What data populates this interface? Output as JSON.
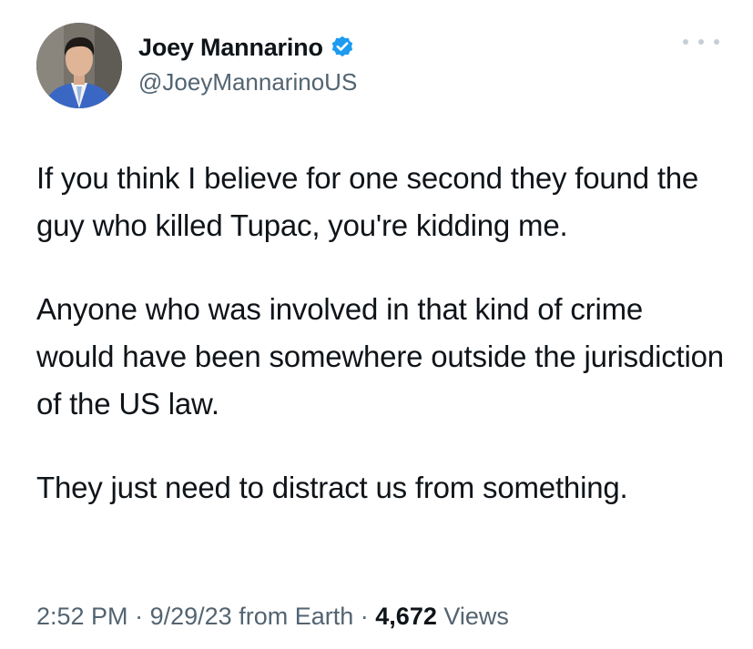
{
  "header": {
    "cut_off_text": "▁ ▬ ▄▃ ▀ ▆▖ ▄ ▆▃ ▂▄▄ ▇▅▆ ▃▄▅▆"
  },
  "author": {
    "display_name": "Joey Mannarino",
    "handle": "@JoeyMannarinoUS",
    "verified": true,
    "verified_color": "#1d9bf0"
  },
  "tweet": {
    "paragraphs": [
      "If you think I believe for one second they found the guy who killed Tupac, you're kidding me.",
      "Anyone who was involved in that kind of crime would have been somewhere outside the jurisdiction of the US law.",
      "They just need to distract us from something."
    ]
  },
  "meta": {
    "time": "2:52 PM",
    "date": "9/29/23",
    "source": "from Earth",
    "separator": "·",
    "views_count": "4,672",
    "views_label": "Views"
  },
  "icons": {
    "more": "more-horizontal-icon",
    "verified": "verified-badge-icon"
  }
}
